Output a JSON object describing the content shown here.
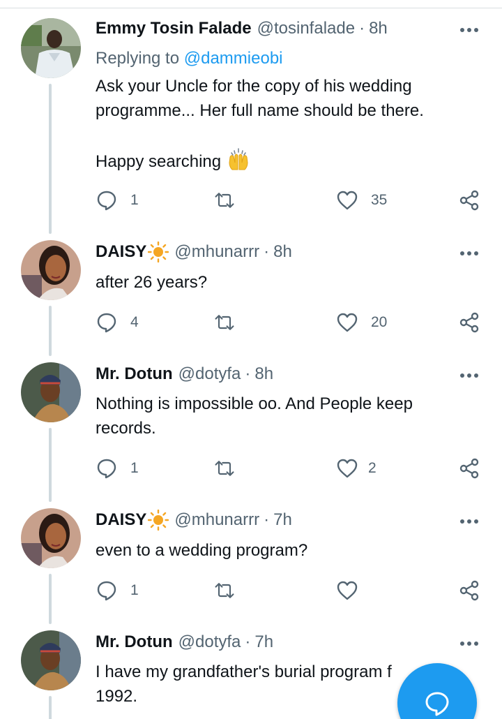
{
  "tweets": [
    {
      "name": "Emmy Tosin Falade",
      "handle": "@tosinfalade",
      "separator": "·",
      "time": "8h",
      "replying_prefix": "Replying to",
      "replying_to": "@dammieobi",
      "lines": [
        "Ask your Uncle for the copy of his wedding",
        "programme... Her full name should be there.",
        "",
        "Happy searching"
      ],
      "emoji": "raising-hands-icon",
      "replies": "1",
      "retweets": "",
      "likes": "35"
    },
    {
      "name": "DAISY",
      "name_icon": "sun-icon",
      "handle": "@mhunarrr",
      "separator": "·",
      "time": "8h",
      "lines": [
        "after 26 years?"
      ],
      "replies": "4",
      "retweets": "",
      "likes": "20"
    },
    {
      "name": "Mr. Dotun",
      "handle": "@dotyfa",
      "separator": "·",
      "time": "8h",
      "lines": [
        "Nothing is impossible oo. And People keep",
        "records."
      ],
      "replies": "1",
      "retweets": "",
      "likes": "2"
    },
    {
      "name": "DAISY",
      "name_icon": "sun-icon",
      "handle": "@mhunarrr",
      "separator": "·",
      "time": "7h",
      "lines": [
        "even to a wedding program?"
      ],
      "replies": "1",
      "retweets": "",
      "likes": ""
    },
    {
      "name": "Mr. Dotun",
      "handle": "@dotyfa",
      "separator": "·",
      "time": "7h",
      "lines": [
        "I have my grandfather's burial program f",
        "1992."
      ]
    }
  ],
  "fab": {
    "icon": "compose-reply-icon"
  },
  "colors": {
    "accent": "#1d9bf0",
    "secondary_text": "#536471",
    "thread_line": "#cfd9de",
    "sun": "#f5a623"
  }
}
